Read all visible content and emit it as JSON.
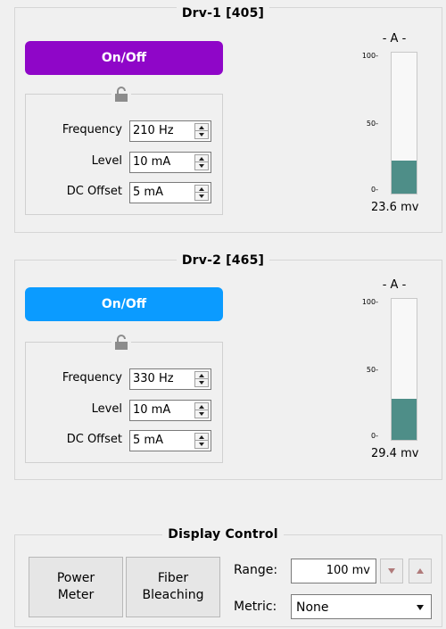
{
  "drivers": [
    {
      "title": "Drv-1  [405]",
      "onoff_label": "On/Off",
      "onoff_color": "#8f06c8",
      "frequency_label": "Frequency",
      "frequency_value": "210 Hz",
      "level_label": "Level",
      "level_value": "10 mA",
      "dc_offset_label": "DC Offset",
      "dc_offset_value": "5 mA",
      "meter": {
        "title": "- A -",
        "tick_max": "100-",
        "tick_mid": "50-",
        "tick_min": "0-",
        "level_percent": 23.6,
        "reading": "23.6 mv"
      }
    },
    {
      "title": "Drv-2  [465]",
      "onoff_label": "On/Off",
      "onoff_color": "#0b9bff",
      "frequency_label": "Frequency",
      "frequency_value": "330 Hz",
      "level_label": "Level",
      "level_value": "10 mA",
      "dc_offset_label": "DC Offset",
      "dc_offset_value": "5 mA",
      "meter": {
        "title": "- A -",
        "tick_max": "100-",
        "tick_mid": "50-",
        "tick_min": "0-",
        "level_percent": 29.4,
        "reading": "29.4 mv"
      }
    }
  ],
  "display_control": {
    "title": "Display Control",
    "power_meter_label": "Power\nMeter",
    "fiber_bleaching_label": "Fiber\nBleaching",
    "range_label": "Range:",
    "range_value": "100 mv",
    "metric_label": "Metric:",
    "metric_value": "None"
  },
  "colors": {
    "meter_fill": "#4e8e88",
    "lock_icon": "#8c8c8c"
  }
}
